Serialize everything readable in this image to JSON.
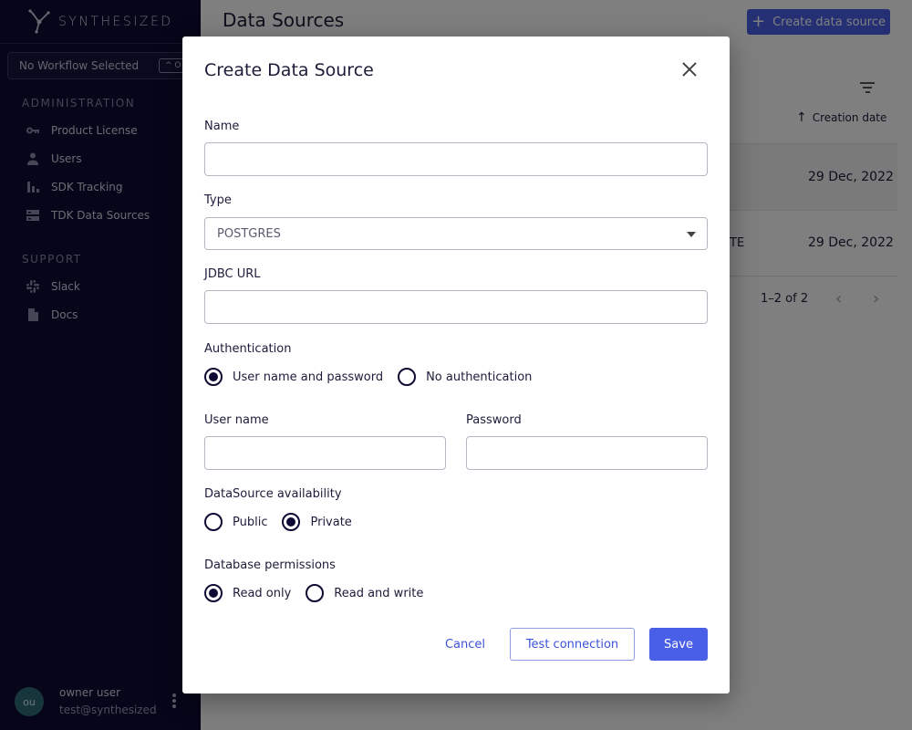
{
  "sidebar": {
    "logo_text": "SYNTHESIZED",
    "workflow": {
      "label": "No Workflow Selected",
      "shortcut": "^ O"
    },
    "admin_section": "ADMINISTRATION",
    "admin_items": [
      {
        "label": "Product License",
        "icon": "key-icon"
      },
      {
        "label": "Users",
        "icon": "person-icon"
      },
      {
        "label": "SDK Tracking",
        "icon": "bar-chart-icon"
      },
      {
        "label": "TDK Data Sources",
        "icon": "storage-icon"
      }
    ],
    "support_section": "SUPPORT",
    "support_items": [
      {
        "label": "Slack",
        "icon": "slack-icon"
      },
      {
        "label": "Docs",
        "icon": "document-icon"
      }
    ],
    "user": {
      "initials": "ou",
      "name": "owner user",
      "email": "test@synthesized.io"
    }
  },
  "main": {
    "title": "Data Sources",
    "create_button": "Create data source",
    "column_header": "Creation date",
    "rows": [
      {
        "date": "29 Dec, 2022"
      },
      {
        "date": "29 Dec, 2022",
        "fragment": "TE"
      }
    ],
    "pagination": "1–2 of 2"
  },
  "modal": {
    "title": "Create Data Source",
    "name_label": "Name",
    "name_value": "",
    "type_label": "Type",
    "type_value": "POSTGRES",
    "jdbc_label": "JDBC URL",
    "jdbc_value": "",
    "auth_label": "Authentication",
    "auth_options": [
      "User name and password",
      "No authentication"
    ],
    "username_label": "User name",
    "password_label": "Password",
    "availability_label": "DataSource availability",
    "availability_options": [
      "Public",
      "Private"
    ],
    "permissions_label": "Database permissions",
    "permissions_options": [
      "Read only",
      "Read and write"
    ],
    "cancel_button": "Cancel",
    "test_button": "Test connection",
    "save_button": "Save"
  },
  "colors": {
    "sidebar_bg": "#0d0b33",
    "accent": "#4a5fe8",
    "radio": "#0d0b33"
  }
}
